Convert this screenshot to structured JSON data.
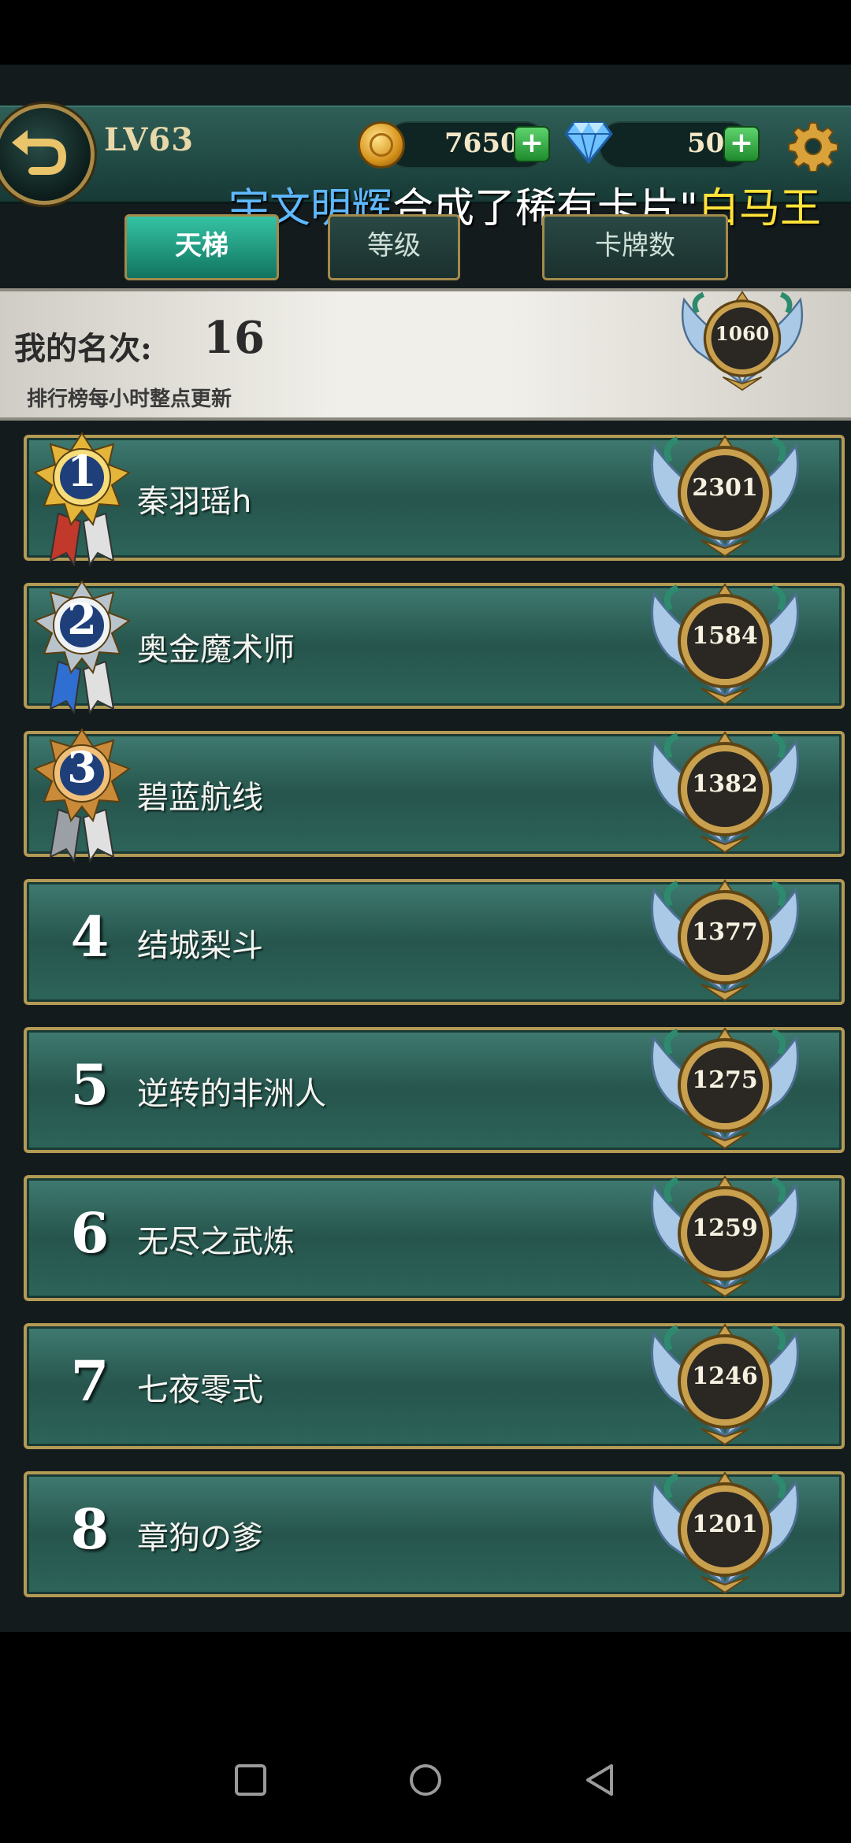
{
  "header": {
    "level": "LV63",
    "gold": "7650",
    "gems": "50",
    "ticker_name": "宇文明辉",
    "ticker_text": "合成了稀有卡片\"",
    "ticker_card": "白马王"
  },
  "tabs": [
    {
      "label": "天梯",
      "active": true
    },
    {
      "label": "等级",
      "active": false
    },
    {
      "label": "卡牌数",
      "active": false
    }
  ],
  "my_rank": {
    "label": "我的名次:",
    "rank": "16",
    "note": "排行榜每小时整点更新",
    "score": "1060"
  },
  "leaderboard": [
    {
      "rank": "1",
      "name": "秦羽瑶h",
      "score": "2301"
    },
    {
      "rank": "2",
      "name": "奥金魔术师",
      "score": "1584"
    },
    {
      "rank": "3",
      "name": "碧蓝航线",
      "score": "1382"
    },
    {
      "rank": "4",
      "name": "结城梨斗",
      "score": "1377"
    },
    {
      "rank": "5",
      "name": "逆转的非洲人",
      "score": "1275"
    },
    {
      "rank": "6",
      "name": "无尽之武炼",
      "score": "1259"
    },
    {
      "rank": "7",
      "name": "七夜零式",
      "score": "1246"
    },
    {
      "rank": "8",
      "name": "章狗の爹",
      "score": "1201"
    }
  ],
  "colors": {
    "accent": "#35c3a4",
    "gold_border": "#b39a55",
    "row_bg": "#2d6459"
  }
}
